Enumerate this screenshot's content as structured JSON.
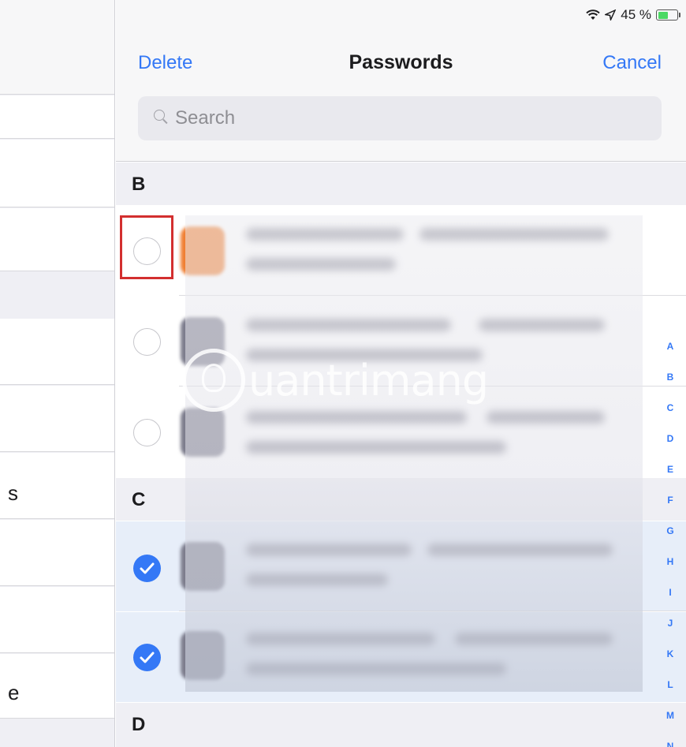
{
  "status_bar": {
    "battery_text": "45 %"
  },
  "nav": {
    "left_label": "Delete",
    "title": "Passwords",
    "right_label": "Cancel"
  },
  "search": {
    "placeholder": "Search"
  },
  "left_pane": {
    "row_fragments": [
      "s",
      "e"
    ]
  },
  "sections": [
    {
      "letter": "B"
    },
    {
      "letter": "C"
    },
    {
      "letter": "D"
    }
  ],
  "rows": [
    {
      "section": "B",
      "selected": false
    },
    {
      "section": "B",
      "selected": false
    },
    {
      "section": "B",
      "selected": false
    },
    {
      "section": "C",
      "selected": true
    },
    {
      "section": "C",
      "selected": true
    }
  ],
  "index_letters": [
    "A",
    "B",
    "C",
    "D",
    "E",
    "F",
    "G",
    "H",
    "I",
    "J",
    "K",
    "L",
    "M",
    "N"
  ],
  "watermark": {
    "text": "uantrimang"
  },
  "colors": {
    "accent": "#3478f6",
    "highlight_box": "#d32f2f",
    "selected_row": "#e7eef9"
  }
}
